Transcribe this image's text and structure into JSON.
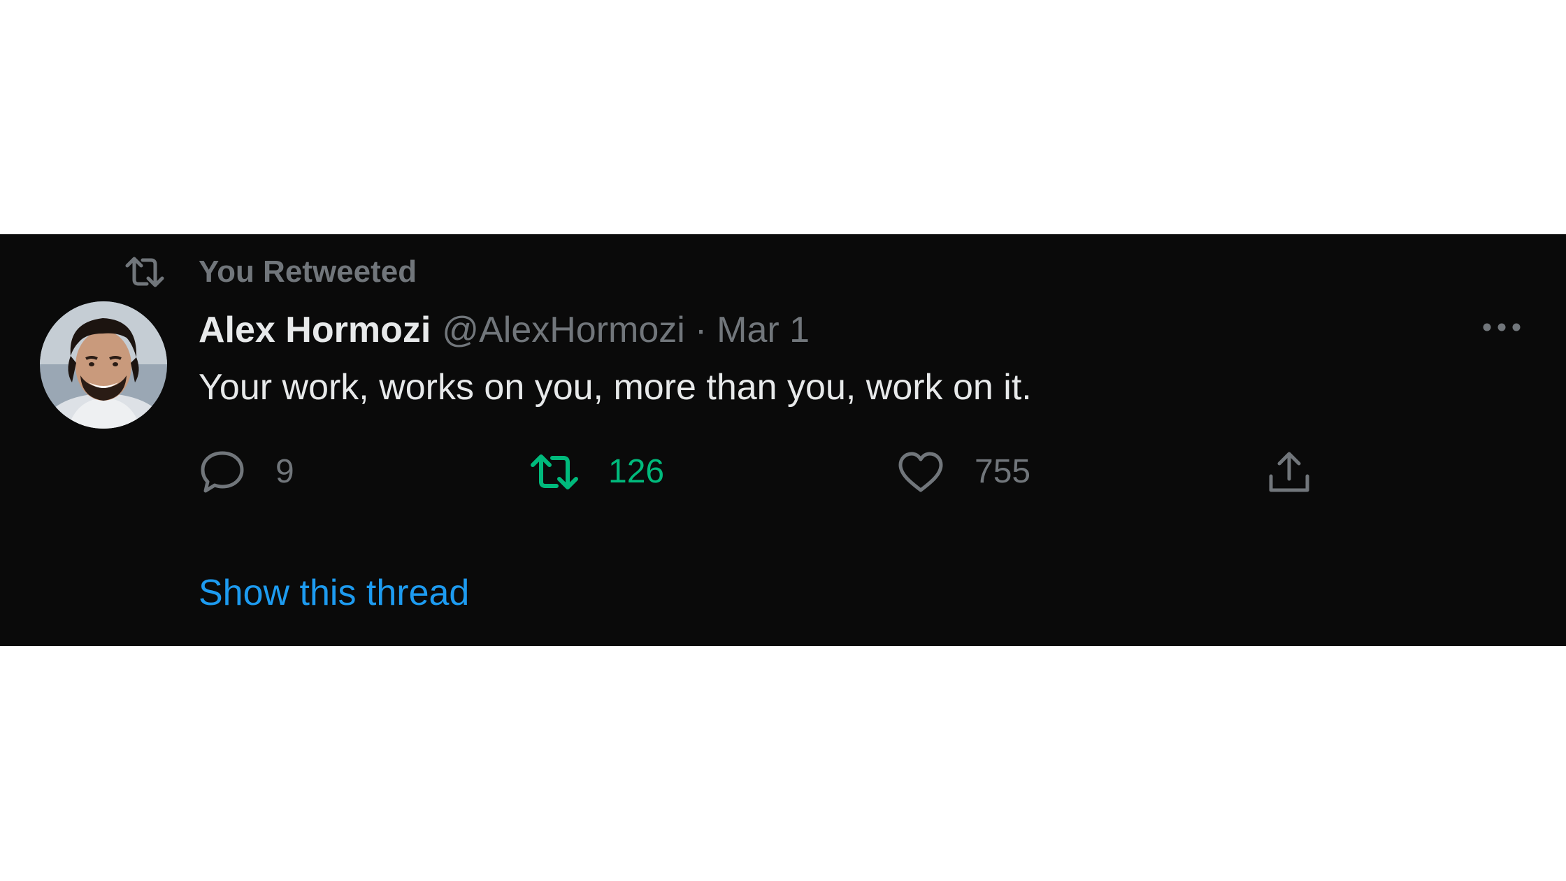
{
  "social_context": {
    "label": "You Retweeted",
    "icon": "retweet-icon"
  },
  "author": {
    "name": "Alex Hormozi",
    "handle": "@AlexHormozi",
    "separator": "·",
    "date": "Mar 1",
    "avatar_icon": "avatar-photo"
  },
  "tweet": {
    "text": "Your work, works on you, more than you, work on it."
  },
  "actions": {
    "reply_count": "9",
    "retweet_count": "126",
    "like_count": "755",
    "retweet_active": true
  },
  "thread_link": {
    "label": "Show this thread"
  },
  "colors": {
    "background": "#0a0a0a",
    "primary_text": "#e7e9ea",
    "secondary_text": "#71767b",
    "retweet_green": "#00ba7c",
    "link_blue": "#1d9bf0"
  }
}
